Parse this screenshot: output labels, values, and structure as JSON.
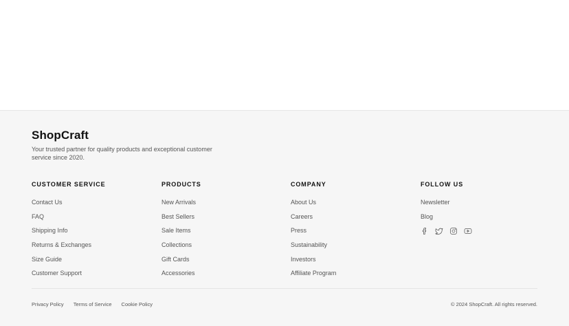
{
  "brand": {
    "name": "ShopCraft",
    "tagline": "Your trusted partner for quality products and exceptional customer service since 2020."
  },
  "columns": [
    {
      "heading": "CUSTOMER SERVICE",
      "links": [
        "Contact Us",
        "FAQ",
        "Shipping Info",
        "Returns & Exchanges",
        "Size Guide",
        "Customer Support"
      ]
    },
    {
      "heading": "PRODUCTS",
      "links": [
        "New Arrivals",
        "Best Sellers",
        "Sale Items",
        "Collections",
        "Gift Cards",
        "Accessories"
      ]
    },
    {
      "heading": "COMPANY",
      "links": [
        "About Us",
        "Careers",
        "Press",
        "Sustainability",
        "Investors",
        "Affiliate Program"
      ]
    },
    {
      "heading": "FOLLOW US",
      "links": [
        "Newsletter",
        "Blog"
      ],
      "social_icons": [
        "facebook-icon",
        "twitter-icon",
        "instagram-icon",
        "youtube-icon"
      ]
    }
  ],
  "bottom": {
    "links": [
      "Privacy Policy",
      "Terms of Service",
      "Cookie Policy"
    ],
    "copyright": "© 2024 ShopCraft. All rights reserved."
  },
  "colors": {
    "footer_background": "#f6f6f6",
    "text_primary": "#111111",
    "text_secondary": "#555555"
  }
}
